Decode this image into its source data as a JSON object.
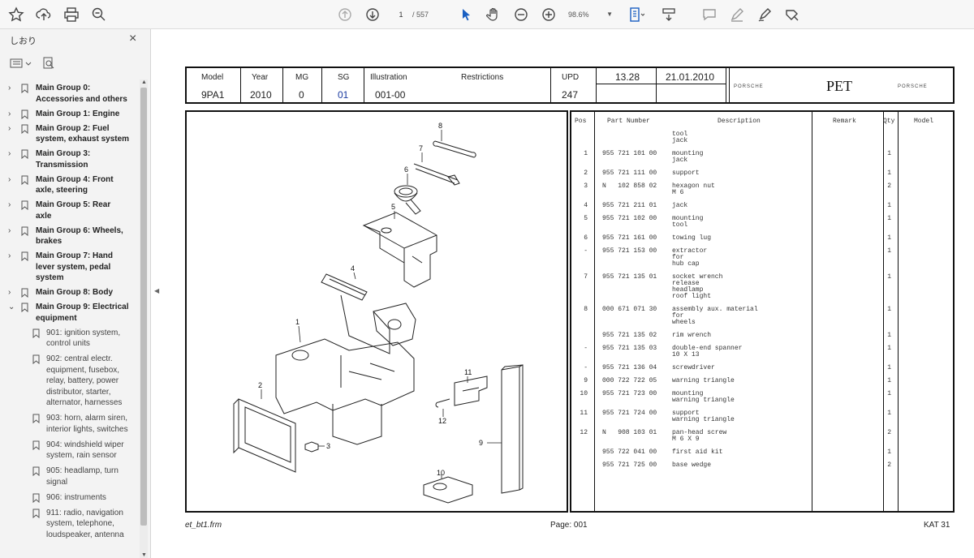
{
  "toolbar": {
    "page_current": "1",
    "page_total": "/ 557",
    "zoom": "98.6%"
  },
  "sidebar": {
    "title": "しおり",
    "items": [
      {
        "label": "Main Group 0: Accessories and others",
        "lines": [
          "Main Group 0:",
          "Accessories and others"
        ],
        "level": 0,
        "expanded": false
      },
      {
        "label": "Main Group 1: Engine",
        "lines": [
          "Main Group 1: Engine"
        ],
        "level": 0,
        "expanded": false
      },
      {
        "label": "Main Group 2: Fuel system, exhaust system",
        "lines": [
          "Main Group 2: Fuel",
          "system, exhaust system"
        ],
        "level": 0,
        "expanded": false
      },
      {
        "label": "Main Group 3: Transmission",
        "lines": [
          "Main Group 3:",
          "Transmission"
        ],
        "level": 0,
        "expanded": false
      },
      {
        "label": "Main Group 4: Front axle, steering",
        "lines": [
          "Main Group 4: Front",
          "axle, steering"
        ],
        "level": 0,
        "expanded": false
      },
      {
        "label": "Main Group 5: Rear axle",
        "lines": [
          "Main Group 5: Rear",
          "axle"
        ],
        "level": 0,
        "expanded": false
      },
      {
        "label": "Main Group 6: Wheels, brakes",
        "lines": [
          "Main Group 6: Wheels,",
          "brakes"
        ],
        "level": 0,
        "expanded": false
      },
      {
        "label": "Main Group 7: Hand lever system, pedal system",
        "lines": [
          "Main Group 7: Hand",
          "lever system, pedal",
          "system"
        ],
        "level": 0,
        "expanded": false
      },
      {
        "label": "Main Group 8: Body",
        "lines": [
          "Main Group 8: Body"
        ],
        "level": 0,
        "expanded": false
      },
      {
        "label": "Main Group 9: Electrical equipment",
        "lines": [
          "Main Group 9: Electrical",
          "equipment"
        ],
        "level": 0,
        "expanded": true
      },
      {
        "label": "901: ignition system, control units",
        "lines": [
          "901: ignition system,",
          "control units"
        ],
        "level": 1
      },
      {
        "label": "902: central electr. equipment, fusebox, relay, battery, power distributor, starter, alternator, harnesses",
        "lines": [
          "902: central electr.",
          "equipment, fusebox,",
          "relay, battery, power",
          "distributor, starter,",
          "alternator, harnesses"
        ],
        "level": 1
      },
      {
        "label": "903: horn, alarm siren, interior lights, switches",
        "lines": [
          "903: horn, alarm siren,",
          "interior lights, switches"
        ],
        "level": 1
      },
      {
        "label": "904: windshield wiper system, rain sensor",
        "lines": [
          "904: windshield wiper",
          "system, rain sensor"
        ],
        "level": 1
      },
      {
        "label": "905: headlamp, turn signal",
        "lines": [
          "905: headlamp, turn",
          "signal"
        ],
        "level": 1
      },
      {
        "label": "906: instruments",
        "lines": [
          "906: instruments"
        ],
        "level": 1
      },
      {
        "label": "911: radio, navigation system, telephone, loudspeaker, antenna",
        "lines": [
          "911: radio, navigation",
          "system, telephone,",
          "loudspeaker, antenna"
        ],
        "level": 1
      }
    ]
  },
  "header": {
    "model_label": "Model",
    "model": "9PA1",
    "year_label": "Year",
    "year": "2010",
    "mg_label": "MG",
    "mg": "0",
    "sg_label": "SG",
    "sg": "01",
    "illustration_label": "Illustration",
    "illustration": "001-00",
    "restrictions_label": "Restrictions",
    "upd_label": "UPD",
    "upd": "247",
    "version": "13.28",
    "date": "21.01.2010",
    "brand_left": "PORSCHE",
    "pet": "PET",
    "brand_right": "PORSCHE"
  },
  "parts_table": {
    "columns": [
      "Pos",
      "Part Number",
      "Description",
      "Remark",
      "Qty",
      "Model"
    ],
    "rows": [
      {
        "pos": "",
        "part": "",
        "desc": [
          "tool",
          "jack"
        ],
        "qty": ""
      },
      {
        "pos": "1",
        "part": "955 721 101 00",
        "desc": [
          "mounting",
          "jack"
        ],
        "qty": "1"
      },
      {
        "pos": "2",
        "part": "955 721 111 00",
        "desc": [
          "support"
        ],
        "qty": "1"
      },
      {
        "pos": "3",
        "part": "N   102 858 02",
        "desc": [
          "hexagon nut",
          "M 6"
        ],
        "qty": "2"
      },
      {
        "pos": "4",
        "part": "955 721 211 01",
        "desc": [
          "jack"
        ],
        "qty": "1"
      },
      {
        "pos": "5",
        "part": "955 721 102 00",
        "desc": [
          "mounting",
          "tool"
        ],
        "qty": "1"
      },
      {
        "pos": "6",
        "part": "955 721 161 00",
        "desc": [
          "towing lug"
        ],
        "qty": "1"
      },
      {
        "pos": "-",
        "part": "955 721 153 00",
        "desc": [
          "extractor",
          "for",
          "hub cap"
        ],
        "qty": "1"
      },
      {
        "pos": "7",
        "part": "955 721 135 01",
        "desc": [
          "socket wrench",
          "release",
          "headlamp",
          "roof light"
        ],
        "qty": "1"
      },
      {
        "pos": "8",
        "part": "000 671 071 30",
        "desc": [
          "assembly aux. material",
          "for",
          "wheels"
        ],
        "qty": "1"
      },
      {
        "pos": "",
        "part": "955 721 135 02",
        "desc": [
          "rim wrench"
        ],
        "qty": "1"
      },
      {
        "pos": "-",
        "part": "955 721 135 03",
        "desc": [
          "double-end spanner",
          "10 X 13"
        ],
        "qty": "1"
      },
      {
        "pos": "-",
        "part": "955 721 136 04",
        "desc": [
          "screwdriver"
        ],
        "qty": "1"
      },
      {
        "pos": "9",
        "part": "000 722 722 05",
        "desc": [
          "warning triangle"
        ],
        "qty": "1"
      },
      {
        "pos": "10",
        "part": "955 721 723 00",
        "desc": [
          "mounting",
          "warning triangle"
        ],
        "qty": "1"
      },
      {
        "pos": "11",
        "part": "955 721 724 00",
        "desc": [
          "support",
          "warning triangle"
        ],
        "qty": "1"
      },
      {
        "pos": "12",
        "part": "N   908 103 01",
        "desc": [
          "pan-head screw",
          "M 6 X 9"
        ],
        "qty": "2"
      },
      {
        "pos": "",
        "part": "955 722 041 00",
        "desc": [
          "first aid kit"
        ],
        "qty": "1"
      },
      {
        "pos": "",
        "part": "955 721 725 00",
        "desc": [
          "base wedge"
        ],
        "qty": "2"
      }
    ]
  },
  "illustration": {
    "callouts": [
      "1",
      "2",
      "3",
      "4",
      "5",
      "6",
      "7",
      "8",
      "9",
      "10",
      "11",
      "12"
    ]
  },
  "footer": {
    "left": "et_bt1.frm",
    "center": "Page: 001",
    "right": "KAT 31"
  }
}
